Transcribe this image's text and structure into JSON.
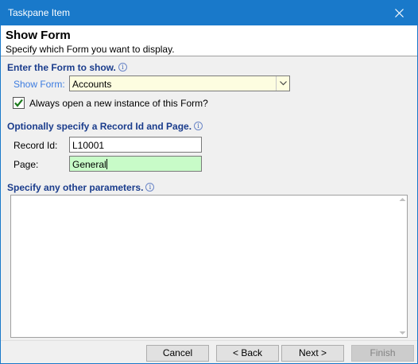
{
  "window": {
    "title": "Taskpane Item"
  },
  "header": {
    "title": "Show Form",
    "subtitle": "Specify which Form you want to display."
  },
  "form_section": {
    "heading": "Enter the Form to show.",
    "show_form_label": "Show Form:",
    "show_form_value": "Accounts",
    "always_new_label": "Always open a new instance of this Form?",
    "always_new_checked": true
  },
  "record_section": {
    "heading": "Optionally specify a Record Id and Page.",
    "record_id_label": "Record Id:",
    "record_id_value": "L10001",
    "page_label": "Page:",
    "page_value": "General"
  },
  "params_section": {
    "heading": "Specify any other parameters.",
    "value": ""
  },
  "buttons": {
    "cancel": "Cancel",
    "back": "< Back",
    "next": "Next >",
    "finish": "Finish"
  },
  "colors": {
    "titlebar": "#1979ca",
    "section_heading": "#1a3c8c",
    "label_blue": "#3c7ce0",
    "combo_bg": "#fdfde0",
    "page_bg": "#c8fbc8"
  }
}
